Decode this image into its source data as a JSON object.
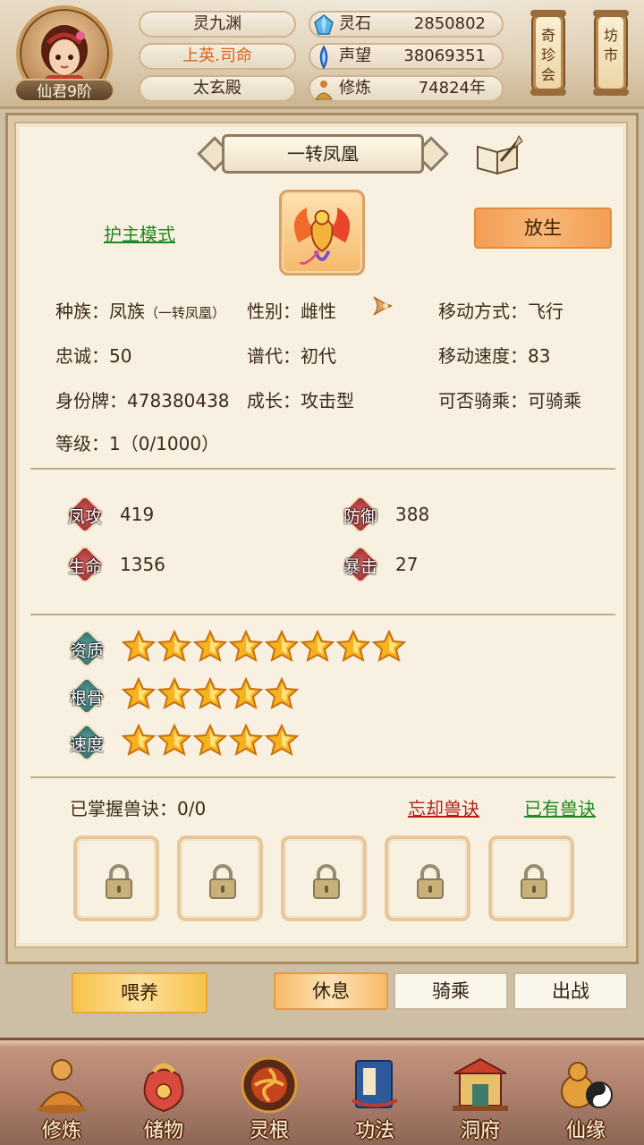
{
  "header": {
    "rank": "仙君9阶",
    "realm": "灵九渊",
    "title": "上英.司命",
    "sect": "太玄殿",
    "resources": [
      {
        "icon": "spirit-stone-icon",
        "label": "灵石",
        "value": "2850802"
      },
      {
        "icon": "reputation-icon",
        "label": "声望",
        "value": "38069351"
      },
      {
        "icon": "cultivation-icon",
        "label": "修炼",
        "value": "74824年"
      }
    ],
    "scroll_buttons": [
      "奇珍会",
      "坊市"
    ]
  },
  "pet": {
    "name": "一转凤凰",
    "guard_mode": "护主模式",
    "release": "放生",
    "attrs": {
      "race_label": "种族：",
      "race": "凤族",
      "race_sub": "（一转凤凰）",
      "gender_label": "性别：",
      "gender": "雌性",
      "move_label": "移动方式：",
      "move": "飞行",
      "loyalty_label": "忠诚：",
      "loyalty": "50",
      "gen_label": "谱代：",
      "gen": "初代",
      "speed_label": "移动速度：",
      "speed": "83",
      "id_label": "身份牌：",
      "id": "478380438",
      "growth_label": "成长：",
      "growth": "攻击型",
      "ride_label": "可否骑乘：",
      "ride": "可骑乘",
      "level_label": "等级：",
      "level": "1（0/1000）"
    },
    "stats": [
      {
        "name": "凤攻",
        "value": "419"
      },
      {
        "name": "防御",
        "value": "388"
      },
      {
        "name": "生命",
        "value": "1356"
      },
      {
        "name": "暴击",
        "value": "27"
      }
    ],
    "ratings": [
      {
        "name": "资质",
        "stars": 8
      },
      {
        "name": "根骨",
        "stars": 5
      },
      {
        "name": "速度",
        "stars": 5
      }
    ],
    "skills_label": "已掌握兽诀：0/0",
    "forget_skill": "忘却兽诀",
    "owned_skill": "已有兽诀",
    "skill_slots": 5
  },
  "actions": {
    "feed": "喂养",
    "tabs": [
      "休息",
      "骑乘",
      "出战"
    ],
    "active_tab": "休息"
  },
  "nav": [
    "修炼",
    "储物",
    "灵根",
    "功法",
    "洞府",
    "仙缘"
  ],
  "colors": {
    "green_link": "#1d8a21",
    "red_link": "#b0201c",
    "release_orange": "#f39d54",
    "feed_yellow": "#f6c24a"
  }
}
